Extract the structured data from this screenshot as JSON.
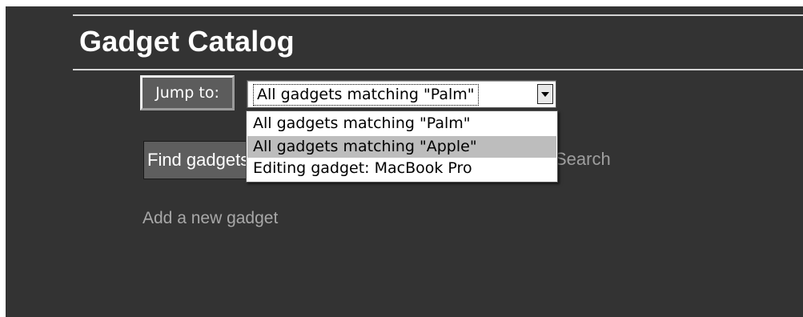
{
  "header": {
    "title": "Gadget Catalog"
  },
  "jump": {
    "label": "Jump to:",
    "selected": "All gadgets matching \"Palm\"",
    "options": [
      "All gadgets matching \"Palm\"",
      "All gadgets matching \"Apple\"",
      "Editing gadget: MacBook Pro"
    ],
    "highlighted_index": 1
  },
  "search": {
    "button_label": "Find gadgets",
    "link_label": "Search"
  },
  "actions": {
    "add_link": "Add a new gadget"
  },
  "colors": {
    "background": "#333333",
    "rule": "#d4d4d4",
    "highlight": "#bdbdbd"
  }
}
